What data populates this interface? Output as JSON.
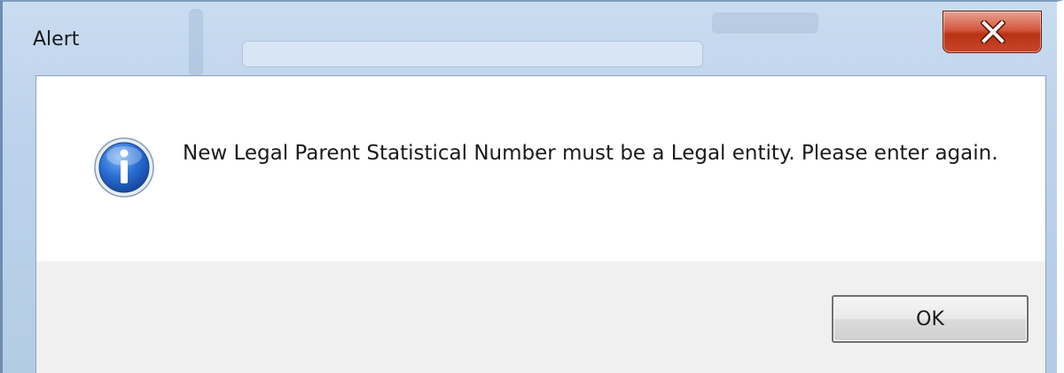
{
  "window": {
    "title": "Alert",
    "close_icon": "close-icon"
  },
  "dialog": {
    "icon": "info-icon",
    "message": "New Legal Parent Statistical Number must be a Legal entity. Please enter again.",
    "ok_label": "OK"
  },
  "colors": {
    "close_button": "#c9442a",
    "info_icon": "#1f5fc4",
    "footer_bg": "#f0f0f0",
    "content_bg": "#ffffff"
  }
}
